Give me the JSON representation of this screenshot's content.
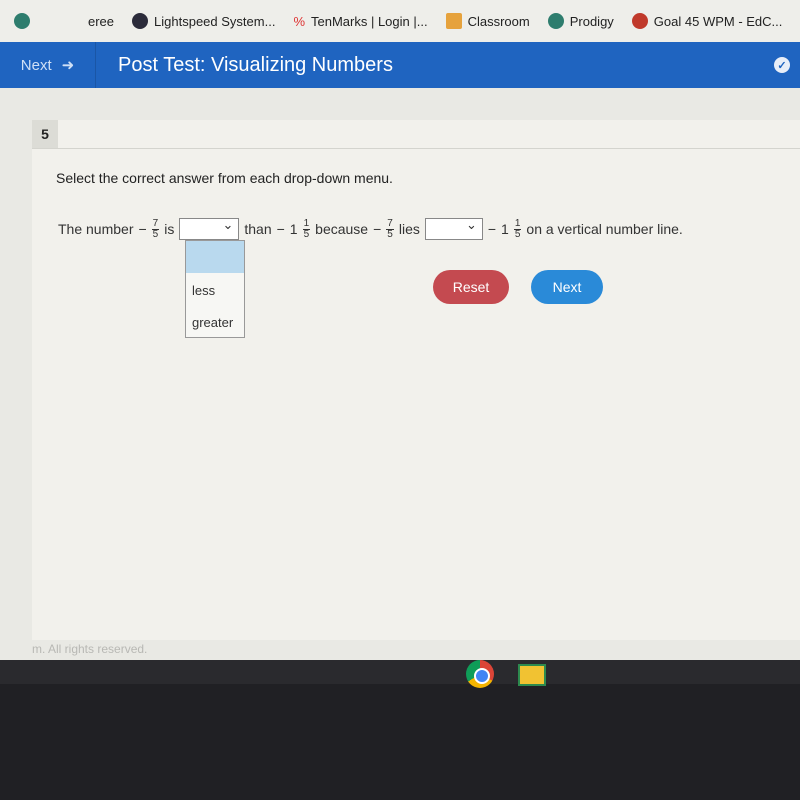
{
  "bookmarks": [
    {
      "label": "",
      "icon": "prodigy-icon"
    },
    {
      "label": "eree",
      "icon": ""
    },
    {
      "label": "Lightspeed System...",
      "icon": "lightspeed-icon"
    },
    {
      "label": "TenMarks | Login |...",
      "icon": "percent-icon"
    },
    {
      "label": "Classroom",
      "icon": "classroom-icon"
    },
    {
      "label": "Prodigy",
      "icon": "prodigy-icon"
    },
    {
      "label": "Goal 45 WPM - EdC...",
      "icon": "edclub-icon"
    }
  ],
  "header": {
    "next_label": "Next",
    "title": "Post Test: Visualizing Numbers"
  },
  "question": {
    "number": "5",
    "instruction": "Select the correct answer from each drop-down menu.",
    "t1": "The number",
    "f1": {
      "sign": "−",
      "num": "7",
      "den": "5"
    },
    "t2": "is",
    "t3": "than",
    "m1": {
      "sign": "−",
      "whole": "1",
      "num": "1",
      "den": "5"
    },
    "t4": "because",
    "f2": {
      "sign": "−",
      "num": "7",
      "den": "5"
    },
    "t5": "lies",
    "m2": {
      "sign": "−",
      "whole": "1",
      "num": "1",
      "den": "5"
    },
    "t6": "on a vertical number line.",
    "dropdown1": {
      "selected": "",
      "options": [
        "less",
        "greater"
      ],
      "open": true
    },
    "dropdown2": {
      "selected": ""
    }
  },
  "buttons": {
    "reset": "Reset",
    "next": "Next"
  },
  "footer": "m. All rights reserved.",
  "colors": {
    "header": "#1f64c0",
    "reset": "#c44a50",
    "next": "#2a8ad8"
  }
}
